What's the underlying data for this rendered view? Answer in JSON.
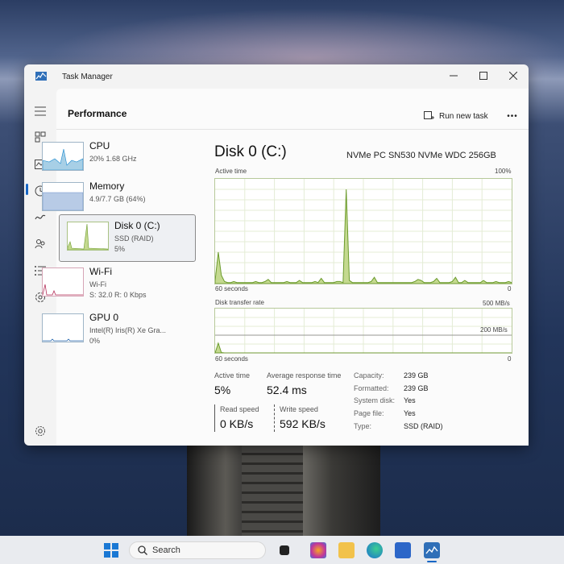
{
  "window": {
    "title": "Task Manager"
  },
  "page": {
    "title": "Performance"
  },
  "toolbar": {
    "run_new_task_label": "Run new task",
    "more_label": "•••"
  },
  "resources": [
    {
      "name": "CPU",
      "sub1": "20%  1.68 GHz",
      "sub2": "",
      "sub3": "",
      "color": "#1a8ad0"
    },
    {
      "name": "Memory",
      "sub1": "4.9/7.7 GB (64%)",
      "sub2": "",
      "sub3": "",
      "color": "#6a8fc9"
    },
    {
      "name": "Disk 0 (C:)",
      "sub1": "SSD (RAID)",
      "sub2": "5%",
      "sub3": "",
      "color": "#6b9b2c"
    },
    {
      "name": "Wi-Fi",
      "sub1": "Wi-Fi",
      "sub2": "S: 32.0  R: 0 Kbps",
      "sub3": "",
      "color": "#b5305a"
    },
    {
      "name": "GPU 0",
      "sub1": "Intel(R) Iris(R) Xe Gra...",
      "sub2": "0%",
      "sub3": "",
      "color": "#2a6ab0"
    }
  ],
  "detail": {
    "title": "Disk 0 (C:)",
    "model": "NVMe PC SN530 NVMe WDC 256GB",
    "active_graph": {
      "label": "Active time",
      "max": "100%",
      "time": "60 seconds",
      "min": "0"
    },
    "transfer_graph": {
      "label": "Disk transfer rate",
      "max": "500 MB/s",
      "mid": "200 MB/s",
      "time": "60 seconds",
      "min": "0"
    },
    "stats": {
      "active_time_label": "Active time",
      "active_time": "5%",
      "avg_resp_label": "Average response time",
      "avg_resp": "52.4 ms",
      "read_label": "Read speed",
      "read": "0 KB/s",
      "write_label": "Write speed",
      "write": "592 KB/s"
    },
    "props": [
      {
        "k": "Capacity:",
        "v": "239 GB"
      },
      {
        "k": "Formatted:",
        "v": "239 GB"
      },
      {
        "k": "System disk:",
        "v": "Yes"
      },
      {
        "k": "Page file:",
        "v": "Yes"
      },
      {
        "k": "Type:",
        "v": "SSD (RAID)"
      }
    ]
  },
  "taskbar": {
    "search_placeholder": "Search"
  },
  "chart_data": [
    {
      "type": "area",
      "title": "Active time",
      "ylim": [
        0,
        100
      ],
      "x_span": "60 seconds",
      "values": [
        3,
        30,
        8,
        2,
        1,
        1,
        2,
        1,
        1,
        1,
        1,
        1,
        1,
        2,
        1,
        1,
        2,
        4,
        1,
        1,
        1,
        1,
        1,
        2,
        1,
        1,
        1,
        3,
        1,
        1,
        1,
        1,
        2,
        1,
        5,
        1,
        1,
        1,
        1,
        2,
        2,
        1,
        90,
        3,
        1,
        1,
        1,
        1,
        1,
        1,
        2,
        6,
        1,
        1,
        1,
        1,
        1,
        1,
        1,
        1,
        1,
        1,
        1,
        1,
        2,
        4,
        3,
        1,
        1,
        1,
        2,
        5,
        1,
        1,
        1,
        1,
        2,
        6,
        1,
        1,
        3,
        1,
        1,
        1,
        1,
        1,
        3,
        1,
        1,
        1,
        2,
        1,
        1,
        1,
        2,
        1
      ]
    },
    {
      "type": "area",
      "title": "Disk transfer rate",
      "ylim": [
        0,
        500
      ],
      "x_span": "60 seconds",
      "values": [
        0,
        110,
        5,
        0,
        0,
        0,
        0,
        0,
        0,
        0,
        0,
        0,
        0,
        0,
        0,
        0,
        0,
        0,
        0,
        0,
        0,
        0,
        0,
        0,
        0,
        0,
        0,
        0,
        0,
        0,
        0,
        0,
        0,
        0,
        0,
        0,
        0,
        0,
        0,
        0,
        0,
        0,
        0,
        0,
        0,
        0,
        0,
        0,
        0,
        0,
        0,
        0,
        0,
        0,
        0,
        0,
        0,
        0,
        0,
        0,
        0,
        0,
        0,
        0,
        0,
        0,
        0,
        0,
        0,
        0,
        0,
        0,
        0,
        0,
        0,
        0,
        0,
        0,
        0,
        0,
        0,
        0,
        0,
        0,
        0,
        0,
        0,
        0,
        0,
        0,
        0,
        0,
        0,
        0,
        0,
        0
      ]
    }
  ]
}
